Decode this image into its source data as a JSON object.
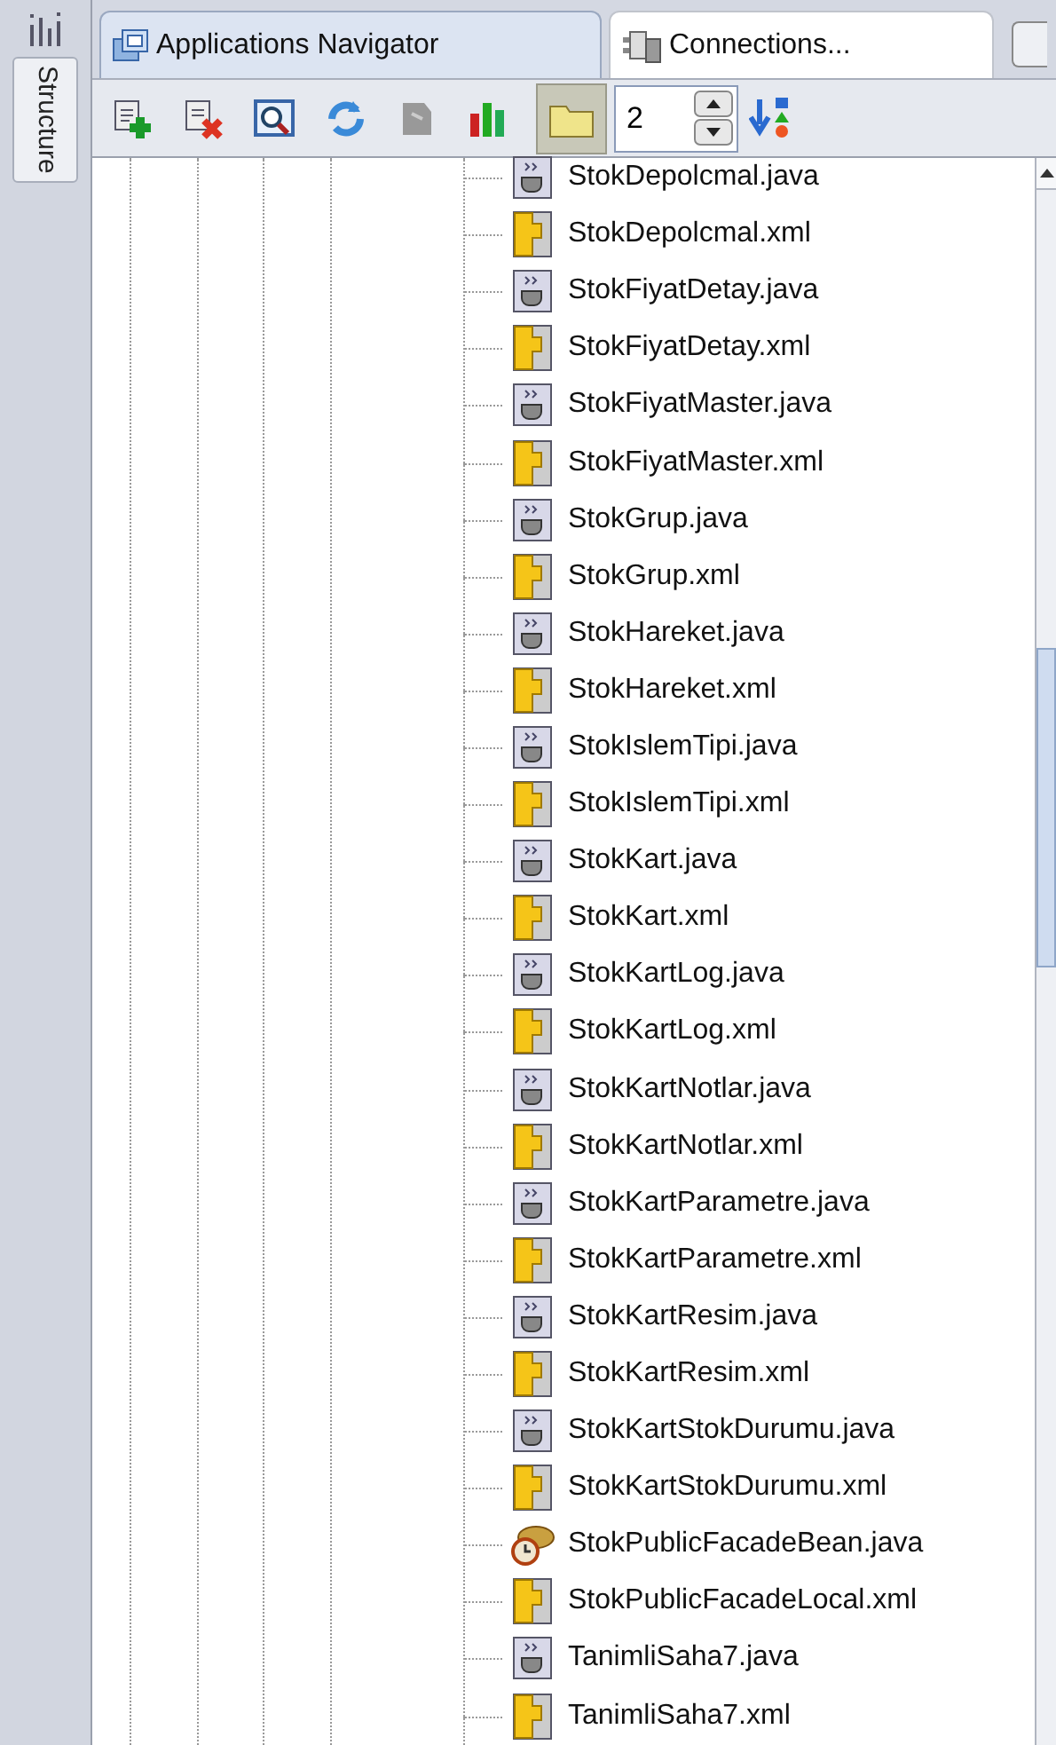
{
  "side_tabs": [
    {
      "label": "Structure"
    }
  ],
  "tabs": [
    {
      "label": "Applications Navigator",
      "selected": true
    },
    {
      "label": "Connections...",
      "selected": false
    }
  ],
  "toolbar": {
    "spinner": {
      "value": "2"
    },
    "folder_toggle": {
      "on": true
    }
  },
  "tree": {
    "items": [
      {
        "label": "StokDepolcmal.java",
        "kind": "java"
      },
      {
        "label": "StokDepolcmal.xml",
        "kind": "xml"
      },
      {
        "label": "StokFiyatDetay.java",
        "kind": "java"
      },
      {
        "label": "StokFiyatDetay.xml",
        "kind": "xml"
      },
      {
        "label": "StokFiyatMaster.java",
        "kind": "java"
      },
      {
        "label": "StokFiyatMaster.xml",
        "kind": "xml"
      },
      {
        "label": "StokGrup.java",
        "kind": "java"
      },
      {
        "label": "StokGrup.xml",
        "kind": "xml"
      },
      {
        "label": "StokHareket.java",
        "kind": "java"
      },
      {
        "label": "StokHareket.xml",
        "kind": "xml"
      },
      {
        "label": "StokIslemTipi.java",
        "kind": "java"
      },
      {
        "label": "StokIslemTipi.xml",
        "kind": "xml"
      },
      {
        "label": "StokKart.java",
        "kind": "java"
      },
      {
        "label": "StokKart.xml",
        "kind": "xml"
      },
      {
        "label": "StokKartLog.java",
        "kind": "java"
      },
      {
        "label": "StokKartLog.xml",
        "kind": "xml"
      },
      {
        "label": "StokKartNotlar.java",
        "kind": "java"
      },
      {
        "label": "StokKartNotlar.xml",
        "kind": "xml"
      },
      {
        "label": "StokKartParametre.java",
        "kind": "java"
      },
      {
        "label": "StokKartParametre.xml",
        "kind": "xml"
      },
      {
        "label": "StokKartResim.java",
        "kind": "java"
      },
      {
        "label": "StokKartResim.xml",
        "kind": "xml"
      },
      {
        "label": "StokKartStokDurumu.java",
        "kind": "java"
      },
      {
        "label": "StokKartStokDurumu.xml",
        "kind": "xml"
      },
      {
        "label": "StokPublicFacadeBean.java",
        "kind": "bean"
      },
      {
        "label": "StokPublicFacadeLocal.xml",
        "kind": "xml"
      },
      {
        "label": "TanimliSaha7.java",
        "kind": "java"
      },
      {
        "label": "TanimliSaha7.xml",
        "kind": "xml"
      }
    ]
  }
}
